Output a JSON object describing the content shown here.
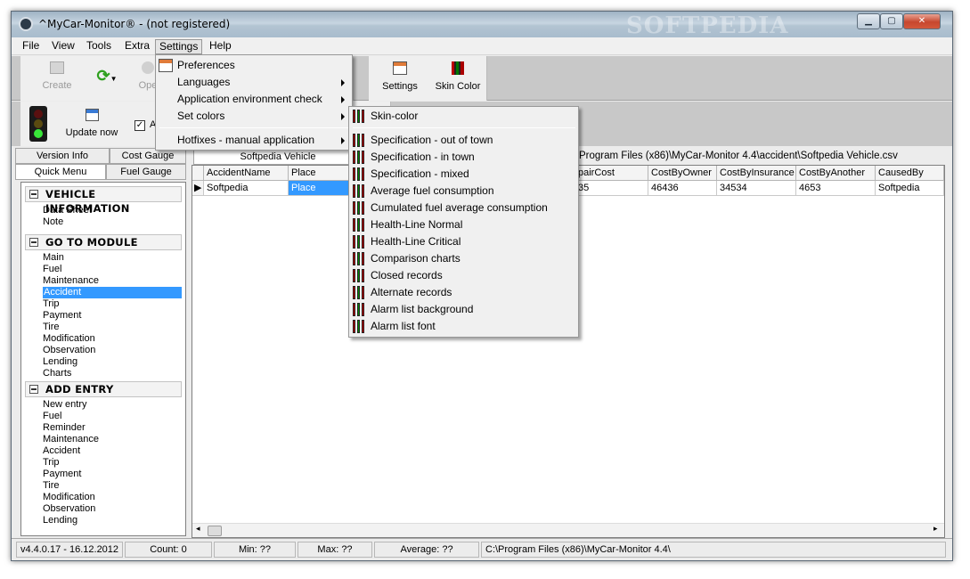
{
  "window": {
    "title": "^MyCar-Monitor® - (not registered)",
    "watermark": "SOFTPEDIA",
    "controls": [
      "minimize",
      "maximize",
      "close"
    ]
  },
  "menubar": [
    "File",
    "View",
    "Tools",
    "Extra",
    "Settings",
    "Help"
  ],
  "toolbar": {
    "create": "Create",
    "open_partial": "Ope",
    "settings": "Settings",
    "skin_color": "Skin Color",
    "update_now": "Update now",
    "auto_partial": "A"
  },
  "left_panel": {
    "tabs_row1": [
      "Version Info",
      "Cost Gauge"
    ],
    "tabs_row2": [
      "Quick Menu",
      "Fuel Gauge"
    ],
    "sections": [
      {
        "title": "VEHICLE INFORMATION",
        "items": [
          "Data Sheet",
          "Note"
        ]
      },
      {
        "title": "GO TO MODULE",
        "items": [
          "Main",
          "Fuel",
          "Maintenance",
          "Accident",
          "Trip",
          "Payment",
          "Tire",
          "Modification",
          "Observation",
          "Lending",
          "Charts"
        ]
      },
      {
        "title": "ADD ENTRY",
        "items": [
          "New entry",
          "Fuel",
          "Reminder",
          "Maintenance",
          "Accident",
          "Trip",
          "Payment",
          "Tire",
          "Modification",
          "Observation",
          "Lending"
        ]
      }
    ],
    "selected_item": "Accident"
  },
  "grid": {
    "vehicle_tab": "Softpedia Vehicle",
    "path": "C:\\Program Files (x86)\\MyCar-Monitor 4.4\\accident\\Softpedia Vehicle.csv",
    "path_visible": "Program Files (x86)\\MyCar-Monitor 4.4\\accident\\Softpedia Vehicle.csv",
    "columns": [
      "AccidentName",
      "Place",
      "RepairCost",
      "CostByOwner",
      "CostByInsurance",
      "CostByAnother",
      "CausedBy"
    ],
    "columns_visible": [
      "AccidentName",
      "Place",
      "pairCost",
      "CostByOwner",
      "CostByInsurance",
      "CostByAnother",
      "CausedBy"
    ],
    "rows": [
      [
        "Softpedia",
        "Place",
        "35",
        "46436",
        "34534",
        "4653",
        "Softpedia"
      ]
    ]
  },
  "settings_menu": {
    "items": [
      "Preferences",
      "Languages",
      "Application environment check",
      "Set colors",
      "Hotfixes - manual application"
    ],
    "submenu_flags": [
      false,
      true,
      true,
      true,
      true
    ]
  },
  "set_colors_menu": {
    "items": [
      "Skin-color",
      "Specification - out of town",
      "Specification - in town",
      "Specification - mixed",
      "Average fuel consumption",
      "Cumulated fuel average consumption",
      "Health-Line Normal",
      "Health-Line Critical",
      "Comparison charts",
      "Closed records",
      "Alternate records",
      "Alarm list background",
      "Alarm list font"
    ]
  },
  "statusbar": {
    "version": "v4.4.0.17 - 16.12.2012",
    "count": "Count: 0",
    "min": "Min: ??",
    "max": "Max: ??",
    "average": "Average: ??",
    "path": "C:\\Program Files (x86)\\MyCar-Monitor 4.4\\"
  },
  "colors": {
    "selection": "#3399ff",
    "title_gradient_top": "#9fb3c4",
    "close_button": "#c7472e"
  }
}
